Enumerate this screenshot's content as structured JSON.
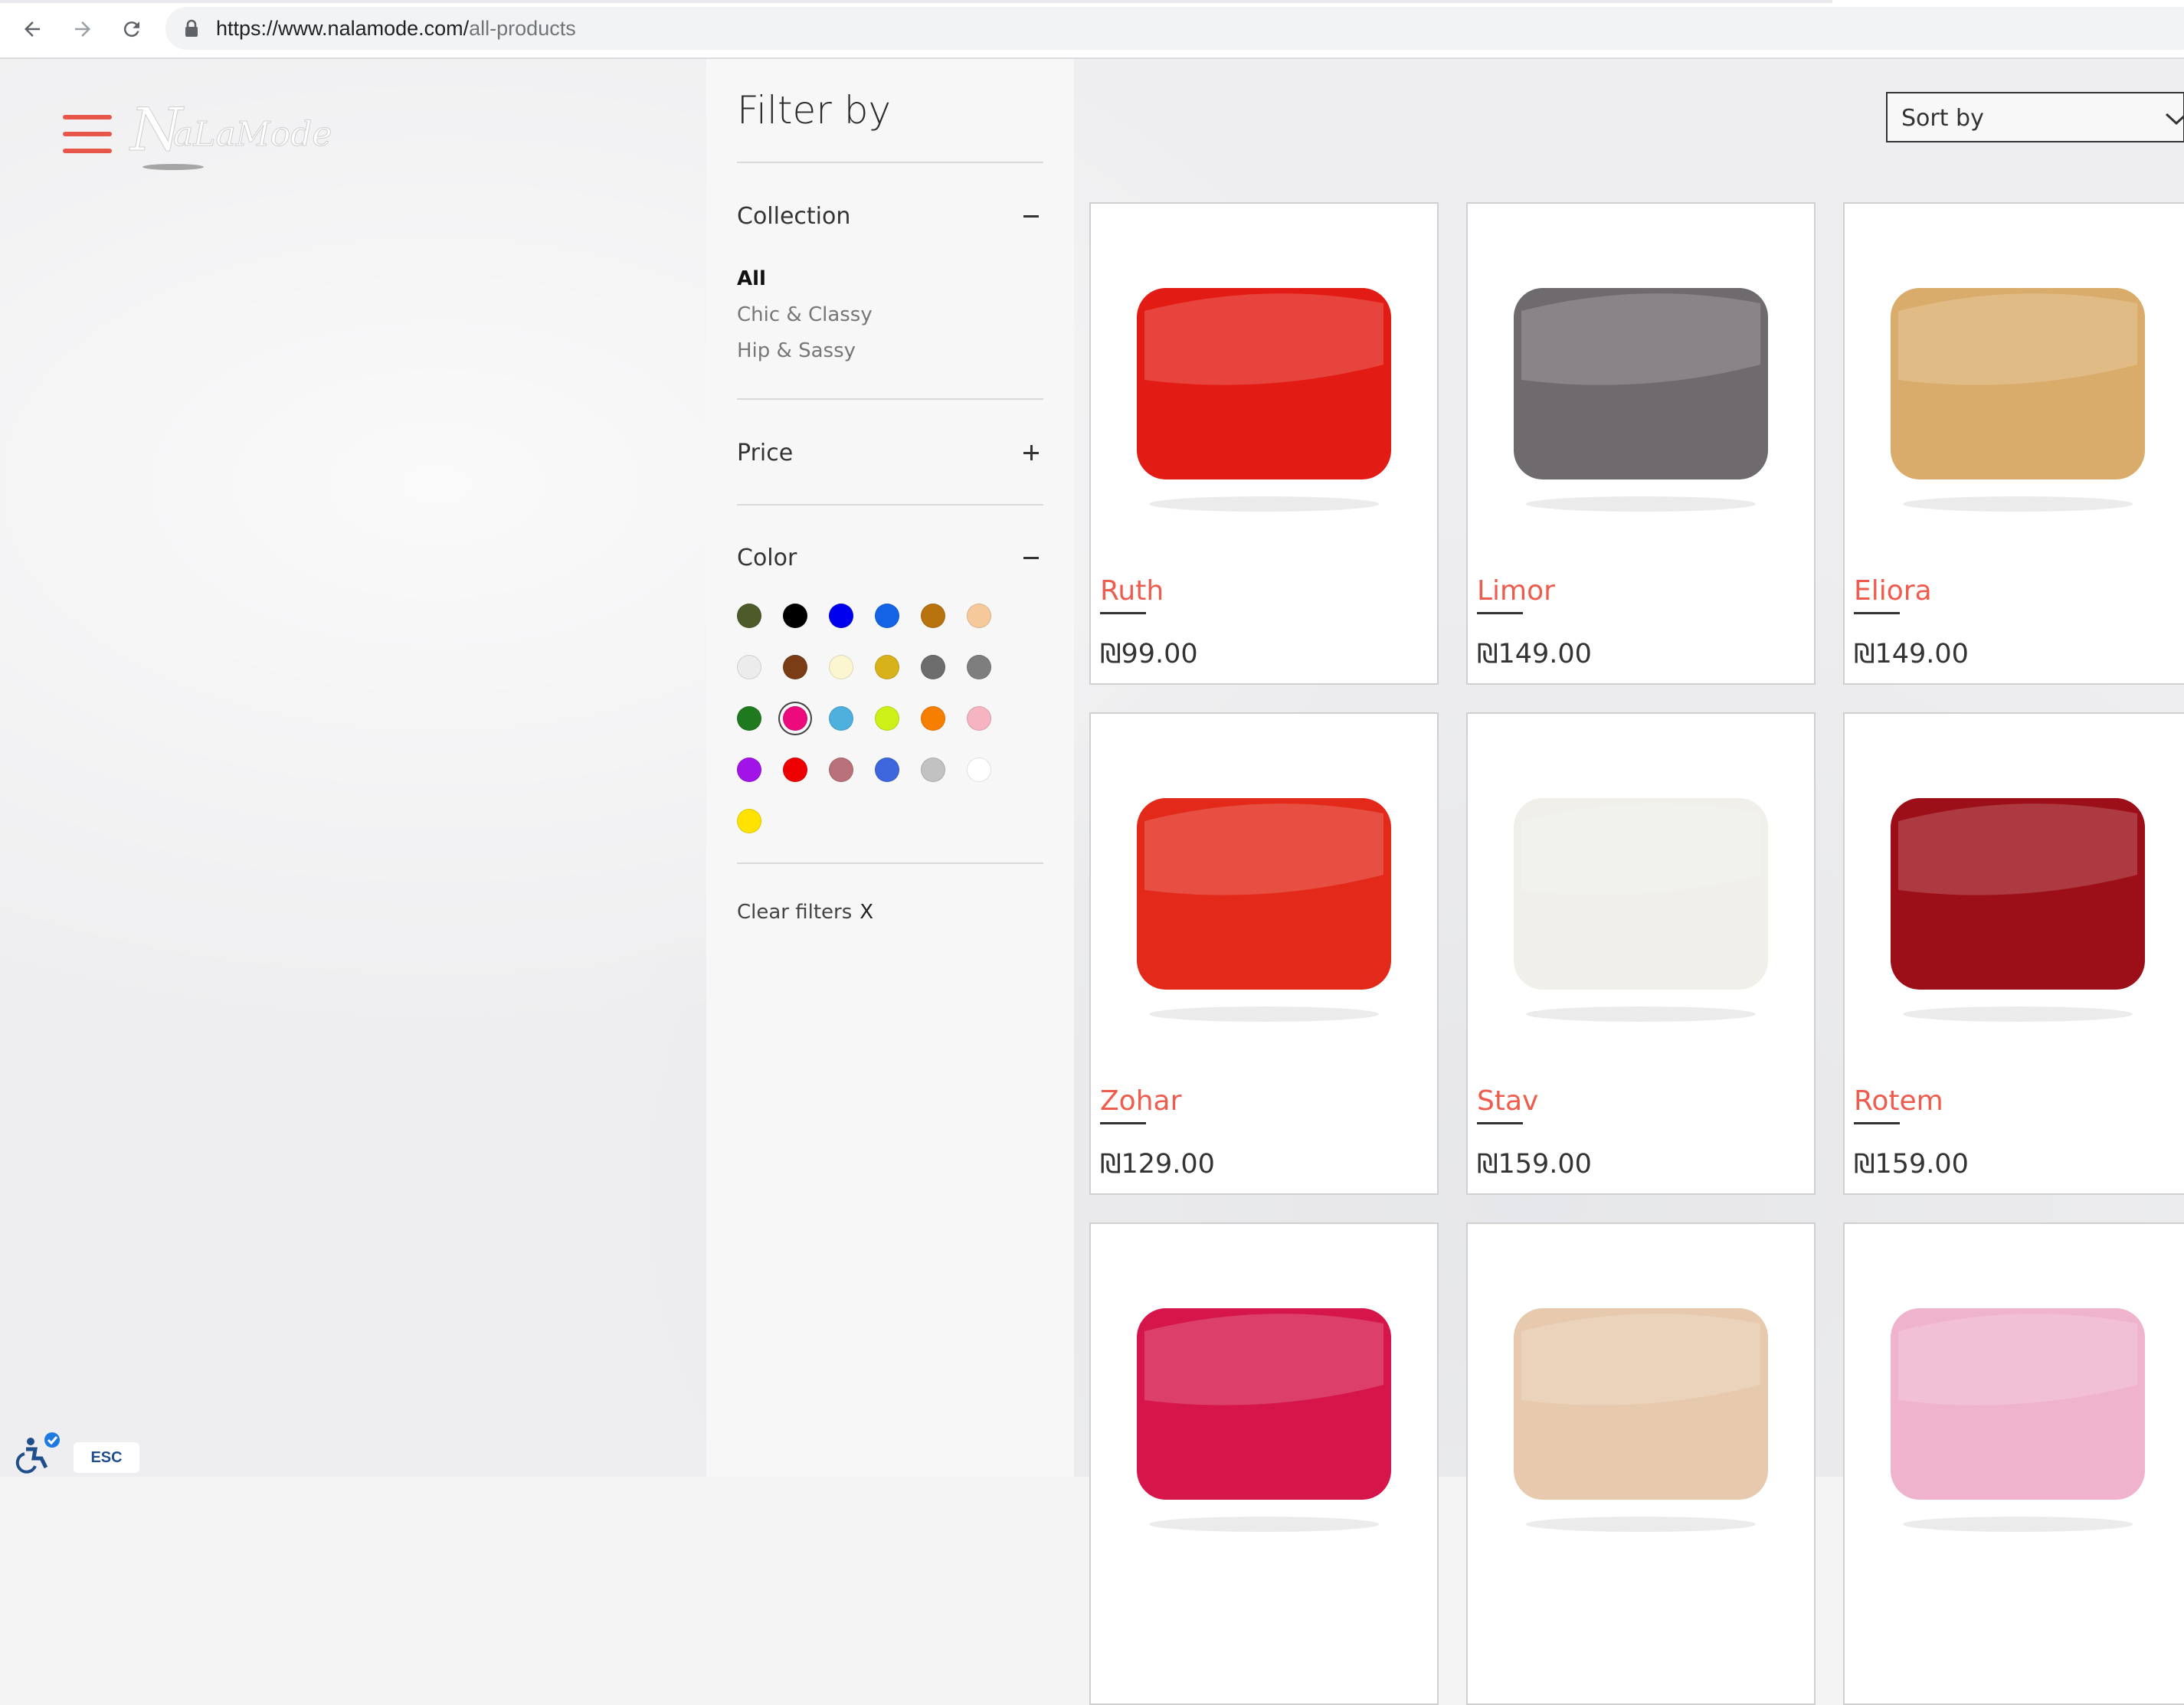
{
  "browser": {
    "url_host": "https://www.nalamode.com/",
    "url_path": "all-products"
  },
  "brand": {
    "logo_text": "NaLaMode"
  },
  "filter": {
    "title": "Filter by",
    "collection": {
      "label": "Collection",
      "items": [
        {
          "label": "All",
          "active": true
        },
        {
          "label": "Chic & Classy",
          "active": false
        },
        {
          "label": "Hip & Sassy",
          "active": false
        }
      ]
    },
    "price": {
      "label": "Price"
    },
    "color": {
      "label": "Color",
      "selected_index": 13,
      "swatches": [
        "#4d5a2a",
        "#000000",
        "#0000ee",
        "#1463e6",
        "#b8730f",
        "#f6c99a",
        "#ececec",
        "#7a3d16",
        "#fbf6cf",
        "#d8b21a",
        "#6d6d6d",
        "#7e7e7e",
        "#1f7a1f",
        "#ec0a7c",
        "#4eb0dd",
        "#ccf018",
        "#f77f00",
        "#f6b3c1",
        "#a113e6",
        "#ef0000",
        "#b87178",
        "#3e67dd",
        "#c2c2c2",
        "#ffffff",
        "#ffe200"
      ]
    },
    "clear_label": "Clear filters",
    "clear_x": "X"
  },
  "sort": {
    "label": "Sort by"
  },
  "products": [
    {
      "name": "Ruth",
      "price": "₪99.00",
      "swatch": "#e21c14"
    },
    {
      "name": "Limor",
      "price": "₪149.00",
      "swatch": "#6e6a6d"
    },
    {
      "name": "Eliora",
      "price": "₪149.00",
      "swatch": "#d9ac6b"
    },
    {
      "name": "Zohar",
      "price": "₪129.00",
      "swatch": "#e2291a"
    },
    {
      "name": "Stav",
      "price": "₪159.00",
      "swatch": "#f0efea"
    },
    {
      "name": "Rotem",
      "price": "₪159.00",
      "swatch": "#9c0e18"
    },
    {
      "name": "",
      "price": "",
      "swatch": "#d6154b"
    },
    {
      "name": "",
      "price": "",
      "swatch": "#e7c9ad"
    },
    {
      "name": "",
      "price": "",
      "swatch": "#f0b3cd"
    }
  ],
  "a11y": {
    "esc_label": "ESC"
  }
}
